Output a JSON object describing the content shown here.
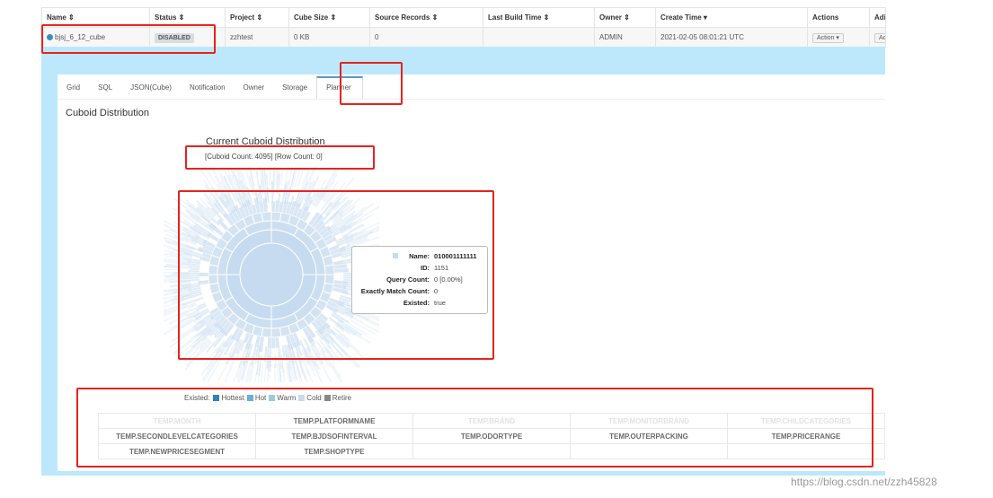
{
  "table": {
    "headers": [
      "Name ⇕",
      "Status ⇕",
      "Project ⇕",
      "Cube Size ⇕",
      "Source Records ⇕",
      "Last Build Time ⇕",
      "Owner ⇕",
      "Create Time ▾",
      "Actions",
      "Adi"
    ],
    "row": {
      "name": "bjsj_6_12_cube",
      "status": "DISABLED",
      "project": "zzhtest",
      "cube_size": "0 KB",
      "source_records": "0",
      "last_build_time": "",
      "owner": "ADMIN",
      "create_time": "2021-02-05 08:01:21 UTC",
      "action_label": "Action ▾",
      "admin_label": "Ac"
    }
  },
  "tabs": [
    "Grid",
    "SQL",
    "JSON(Cube)",
    "Notification",
    "Owner",
    "Storage",
    "Planner"
  ],
  "active_tab": "Planner",
  "section_title": "Cuboid Distribution",
  "chart": {
    "title": "Current Cuboid Distribution",
    "subtitle": "[Cuboid Count: 4095] [Row Count: 0]",
    "color": "#c6dbef"
  },
  "tooltip": {
    "name_label": "Name:",
    "name": "010001111111",
    "id_label": "ID:",
    "id": "1151",
    "query_label": "Query Count:",
    "query": "0 [0.00%]",
    "exact_label": "Exactly Match Count:",
    "exact": "0",
    "existed_label": "Existed:",
    "existed": "true"
  },
  "legend": {
    "label": "Existed:",
    "items": [
      {
        "label": "Hottest",
        "color": "#3182bd"
      },
      {
        "label": "Hot",
        "color": "#6baed6"
      },
      {
        "label": "Warm",
        "color": "#9ecae1"
      },
      {
        "label": "Cold",
        "color": "#c6dbef"
      },
      {
        "label": "Retire",
        "color": "#888888"
      }
    ]
  },
  "dimensions": [
    [
      {
        "t": "TEMP.MONTH",
        "faded": true
      },
      {
        "t": "TEMP.PLATFORMNAME"
      },
      {
        "t": "TEMP.BRAND",
        "faded": true
      },
      {
        "t": "TEMP.MONITORBRAND",
        "faded": true
      },
      {
        "t": "TEMP.CHILDCATEGORIES",
        "faded": true
      }
    ],
    [
      {
        "t": "TEMP.SECONDLEVELCATEGORIES"
      },
      {
        "t": "TEMP.BJDSOFINTERVAL"
      },
      {
        "t": "TEMP.ODORTYPE"
      },
      {
        "t": "TEMP.OUTERPACKING"
      },
      {
        "t": "TEMP.PRICERANGE"
      }
    ],
    [
      {
        "t": "TEMP.NEWPRICESEGMENT"
      },
      {
        "t": "TEMP.SHOPTYPE"
      },
      {
        "t": ""
      },
      {
        "t": ""
      },
      {
        "t": ""
      }
    ]
  ],
  "watermark": "https://blog.csdn.net/zzh45828"
}
